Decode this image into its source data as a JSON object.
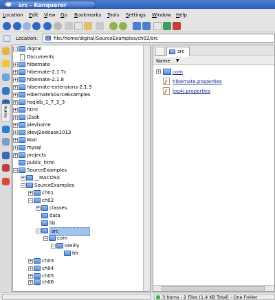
{
  "window": {
    "title": "src - Konqueror"
  },
  "menubar": {
    "items": [
      "Location",
      "Edit",
      "View",
      "Go",
      "Bookmarks",
      "Tools",
      "Settings",
      "Window",
      "Help"
    ]
  },
  "location": {
    "label": "Location:",
    "url": "file:/home/digital/SourceExamples/ch02/src"
  },
  "sidebar": {
    "home_tab": "home"
  },
  "tree": {
    "items": [
      "digital",
      "Documents",
      "hibernate",
      "hibernate-2.1.7c",
      "hibernate-2.1.8",
      "hibernate-extensions-2.1.3",
      "HibernateSourceExamples",
      "hsqldb_1_7_3_3",
      "html",
      "j2sdk",
      "jdevhome",
      "jdevj2eebase1013",
      "Mail",
      "mysql",
      "projects",
      "public_html",
      "SourceExamples",
      "__MACOSX",
      "SourceExamples",
      "ch01",
      "ch02",
      "classes",
      "data",
      "lib",
      "src",
      "com",
      "oreilly",
      "hh",
      "ch03",
      "ch04",
      "ch05",
      "ch06",
      "ch07"
    ]
  },
  "right": {
    "tab_label": "src",
    "column_name": "Name",
    "files": [
      "com",
      "hibernate.properties",
      "log4j.properties"
    ]
  },
  "status": {
    "text": "3 Items - 2 Files (1.4 KB Total) - One Folder"
  },
  "colors": {
    "accent": "#2c5bb5",
    "selection": "#a3c3ec"
  }
}
